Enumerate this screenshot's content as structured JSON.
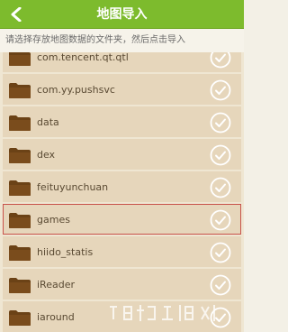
{
  "titlebar": {
    "title": "地图导入",
    "back_icon": "back-arrow-icon"
  },
  "hint": {
    "text": "请选择存放地图数据的文件夹，然后点击导入"
  },
  "colors": {
    "titlebar": "#7dbb2d",
    "row": "#e6d6bb",
    "selected_border": "#c8524a",
    "folder": "#6b4216"
  },
  "folders": [
    {
      "name": "com.tencent.qt.qtl",
      "selected": false
    },
    {
      "name": "com.yy.pushsvc",
      "selected": false
    },
    {
      "name": "data",
      "selected": false
    },
    {
      "name": "dex",
      "selected": false
    },
    {
      "name": "feituyunchuan",
      "selected": false
    },
    {
      "name": "games",
      "selected": true
    },
    {
      "name": "hiido_statis",
      "selected": false
    },
    {
      "name": "iReader",
      "selected": false
    },
    {
      "name": "iaround",
      "selected": false
    }
  ]
}
